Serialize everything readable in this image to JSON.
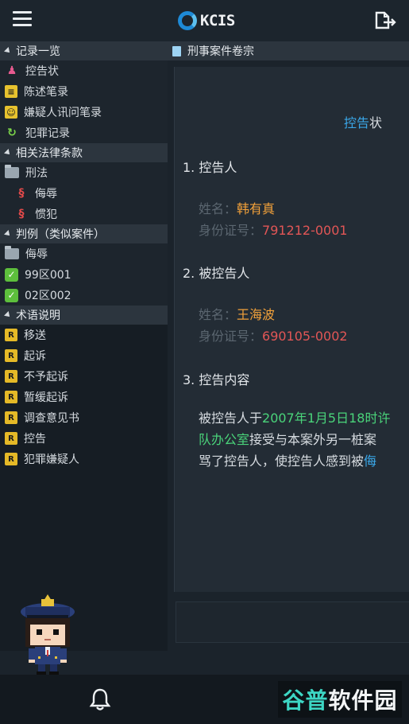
{
  "header": {
    "logo_text": "KCIS",
    "menu_icon": "hamburger-icon",
    "export_icon": "export-icon"
  },
  "sidebar": {
    "sections": [
      {
        "title": "记录一览",
        "items": [
          {
            "label": "控告状",
            "icon": "complaint-icon"
          },
          {
            "label": "陈述笔录",
            "icon": "statement-icon"
          },
          {
            "label": "嫌疑人讯问笔录",
            "icon": "interrogation-icon"
          },
          {
            "label": "犯罪记录",
            "icon": "record-icon"
          }
        ]
      },
      {
        "title": "相关法律条款",
        "items": [
          {
            "label": "刑法",
            "icon": "folder-icon"
          },
          {
            "label": "侮辱",
            "icon": "section-icon"
          },
          {
            "label": "惯犯",
            "icon": "section-icon"
          }
        ]
      },
      {
        "title": "判例（类似案件）",
        "items": [
          {
            "label": "侮辱",
            "icon": "folder-icon"
          },
          {
            "label": "99区001",
            "icon": "check-icon"
          },
          {
            "label": "02区002",
            "icon": "check-icon"
          }
        ]
      },
      {
        "title": "术语说明",
        "items": [
          {
            "label": "移送",
            "icon": "term-icon"
          },
          {
            "label": "起诉",
            "icon": "term-icon"
          },
          {
            "label": "不予起诉",
            "icon": "term-icon"
          },
          {
            "label": "暂缓起诉",
            "icon": "term-icon"
          },
          {
            "label": "调查意见书",
            "icon": "term-icon"
          },
          {
            "label": "控告",
            "icon": "term-icon"
          },
          {
            "label": "犯罪嫌疑人",
            "icon": "term-icon"
          }
        ]
      }
    ]
  },
  "content": {
    "tab_title": "刑事案件卷宗",
    "doc_title_highlight": "控告",
    "doc_title_rest": "状",
    "s1_title": "1. 控告人",
    "s1_name_label": "姓名：",
    "s1_name_value": "韩有真",
    "s1_id_label": "身份证号：",
    "s1_id_value": "791212-0001",
    "s2_title": "2. 被控告人",
    "s2_name_label": "姓名：",
    "s2_name_value": "王海波",
    "s2_id_label": "身份证号：",
    "s2_id_value": "690105-0002",
    "s3_title": "3. 控告内容",
    "body_1a": "被控告人于",
    "body_1b": "2007年1月5日18时许",
    "body_2a": "队办公室",
    "body_2b": "接受与本案外另一桩案",
    "body_3a": "骂了控告人，使控告人感到被",
    "body_3b": "侮"
  },
  "bottombar": {
    "bell_icon": "bell-icon",
    "watermark_1": "谷普",
    "watermark_2": "软件园"
  },
  "colors": {
    "accent_blue": "#3aa7e8",
    "name_orange": "#f2a13a",
    "id_red": "#e25656",
    "green_highlight": "#4ad47a"
  }
}
